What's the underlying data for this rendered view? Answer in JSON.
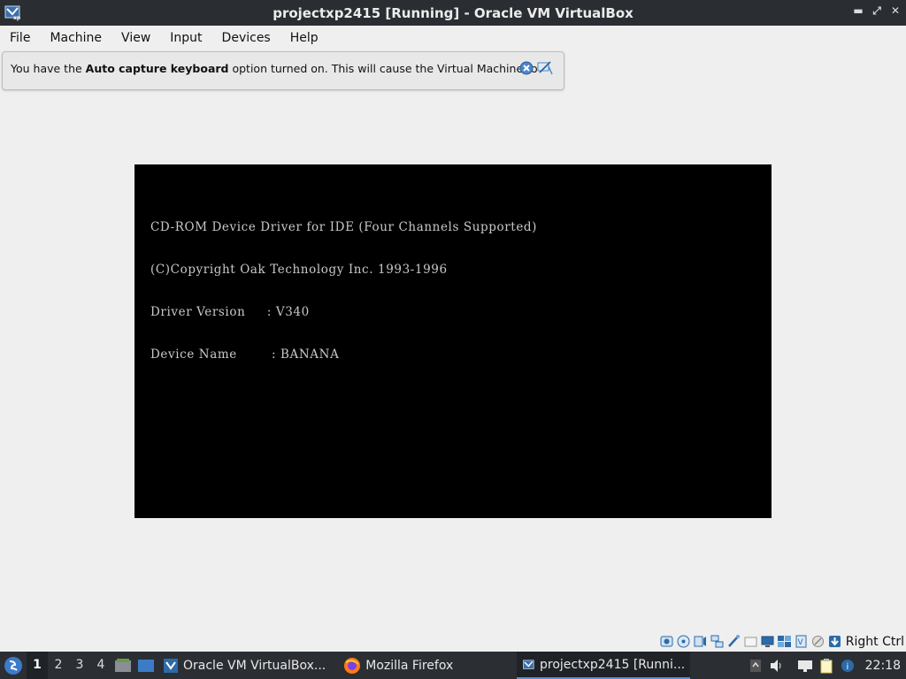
{
  "window": {
    "title": "projectxp2415 [Running] - Oracle VM VirtualBox",
    "controls": [
      "minimize",
      "maximize",
      "close"
    ]
  },
  "menubar": {
    "items": [
      "File",
      "Machine",
      "View",
      "Input",
      "Devices",
      "Help"
    ]
  },
  "notice": {
    "text_before": "You have the ",
    "text_bold": "Auto capture keyboard",
    "text_after": " option turned on. This will cause the Virtual Machine to",
    "icons": [
      "close-notice-icon",
      "do-not-show-again-icon"
    ]
  },
  "vm_console": {
    "lines": [
      "CD-ROM Device Driver for IDE (Four Channels Supported)",
      "(C)Copyright Oak Technology Inc. 1993-1996",
      "Driver Version     : V340",
      "Device Name        : BANANA"
    ]
  },
  "statusbar": {
    "icons": [
      "hard-disk-icon",
      "optical-drive-icon",
      "audio-icon",
      "network-icon",
      "usb-icon",
      "shared-folders-icon",
      "display-icon",
      "video-capture-icon",
      "cpu-icon",
      "mouse-integration-icon",
      "keyboard-capture-icon"
    ],
    "host_key": "Right Ctrl"
  },
  "taskbar": {
    "workspaces": [
      "1",
      "2",
      "3",
      "4"
    ],
    "active_workspace": "1",
    "tasks": [
      {
        "label": "Oracle VM VirtualBox...",
        "icon": "virtualbox-icon"
      },
      {
        "label": "Mozilla Firefox",
        "icon": "firefox-icon"
      },
      {
        "label": "projectxp2415 [Runni...",
        "icon": "vm-window-icon"
      }
    ],
    "clock": "22:18"
  }
}
